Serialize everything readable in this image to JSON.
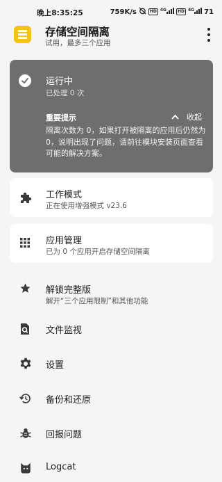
{
  "status_bar": {
    "time": "晚上8:35:25",
    "net_speed": "759K/s",
    "hd1": "HD",
    "hd2": "HD",
    "net_type_1": "4G",
    "net_type_2": "4G",
    "battery": "71"
  },
  "app_bar": {
    "title": "存储空间隔离",
    "subtitle": "试用，最多三个应用"
  },
  "status_card": {
    "title": "运行中",
    "subtitle": "已处理 0 次",
    "notice_title": "重要提示",
    "collapse_label": "收起",
    "notice_text": "隔离次数为 0，如果打开被隔离的应用后仍然为 0，说明出现了问题，请前往模块安装页面查看可能的解决方案。"
  },
  "cards": {
    "work_mode": {
      "title": "工作模式",
      "subtitle": "正在使用增强模式 v23.6"
    },
    "app_manage": {
      "title": "应用管理",
      "subtitle": "已为 0 个应用开启存储空间隔离"
    }
  },
  "menu": {
    "unlock": {
      "title": "解锁完整版",
      "subtitle": "解开“三个应用限制”和其他功能"
    },
    "file_monitor": "文件监视",
    "settings": "设置",
    "backup": "备份和还原",
    "report": "回报问题",
    "logcat": "Logcat"
  },
  "colors": {
    "logo": "#f5c21b",
    "status_card": "#6e6e6e",
    "background": "#f5f5f5"
  }
}
